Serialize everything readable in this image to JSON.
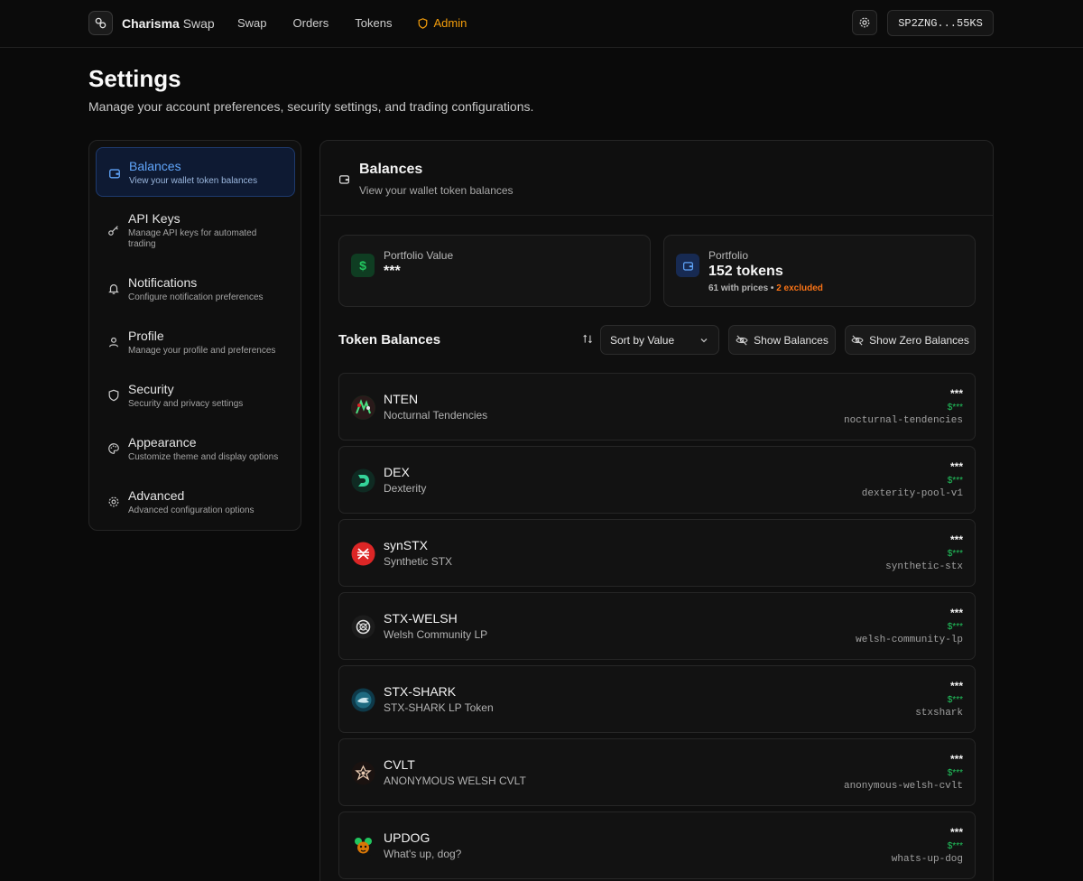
{
  "brand": {
    "name_bold": "Charisma",
    "name_rest": " Swap"
  },
  "nav": {
    "swap": "Swap",
    "orders": "Orders",
    "tokens": "Tokens",
    "admin": "Admin"
  },
  "wallet": {
    "address": "SP2ZNG...55KS"
  },
  "page": {
    "title": "Settings",
    "subtitle": "Manage your account preferences, security settings, and trading configurations."
  },
  "sidebar": {
    "items": [
      {
        "label": "Balances",
        "desc": "View your wallet token balances",
        "icon": "wallet-icon"
      },
      {
        "label": "API Keys",
        "desc": "Manage API keys for automated trading",
        "icon": "key-icon"
      },
      {
        "label": "Notifications",
        "desc": "Configure notification preferences",
        "icon": "bell-icon"
      },
      {
        "label": "Profile",
        "desc": "Manage your profile and preferences",
        "icon": "user-icon"
      },
      {
        "label": "Security",
        "desc": "Security and privacy settings",
        "icon": "shield-icon"
      },
      {
        "label": "Appearance",
        "desc": "Customize theme and display options",
        "icon": "palette-icon"
      },
      {
        "label": "Advanced",
        "desc": "Advanced configuration options",
        "icon": "gear-icon"
      }
    ],
    "active_index": 0
  },
  "panel": {
    "title": "Balances",
    "subtitle": "View your wallet token balances",
    "portfolio_value": {
      "label": "Portfolio Value",
      "value": "***"
    },
    "portfolio": {
      "label": "Portfolio",
      "value": "152 tokens",
      "priced": "61 with prices",
      "sep": " • ",
      "excluded": "2 excluded"
    },
    "token_balances_title": "Token Balances",
    "sort": {
      "selected": "Sort by Value"
    },
    "show_balances": "Show Balances",
    "show_zero": "Show Zero Balances"
  },
  "tokens": [
    {
      "symbol": "NTEN",
      "name": "Nocturnal Tendencies",
      "balance": "***",
      "usd": "$***",
      "contract": "nocturnal-tendencies"
    },
    {
      "symbol": "DEX",
      "name": "Dexterity",
      "balance": "***",
      "usd": "$***",
      "contract": "dexterity-pool-v1"
    },
    {
      "symbol": "synSTX",
      "name": "Synthetic STX",
      "balance": "***",
      "usd": "$***",
      "contract": "synthetic-stx"
    },
    {
      "symbol": "STX-WELSH",
      "name": "Welsh Community LP",
      "balance": "***",
      "usd": "$***",
      "contract": "welsh-community-lp"
    },
    {
      "symbol": "STX-SHARK",
      "name": "STX-SHARK LP Token",
      "balance": "***",
      "usd": "$***",
      "contract": "stxshark"
    },
    {
      "symbol": "CVLT",
      "name": "ANONYMOUS WELSH CVLT",
      "balance": "***",
      "usd": "$***",
      "contract": "anonymous-welsh-cvlt"
    },
    {
      "symbol": "UPDOG",
      "name": "What's up, dog?",
      "balance": "***",
      "usd": "$***",
      "contract": "whats-up-dog"
    }
  ],
  "colors": {
    "accent_blue": "#60a5fa",
    "admin_orange": "#f59e0b",
    "usd_green": "#22c55e",
    "excluded_orange": "#f97316"
  }
}
